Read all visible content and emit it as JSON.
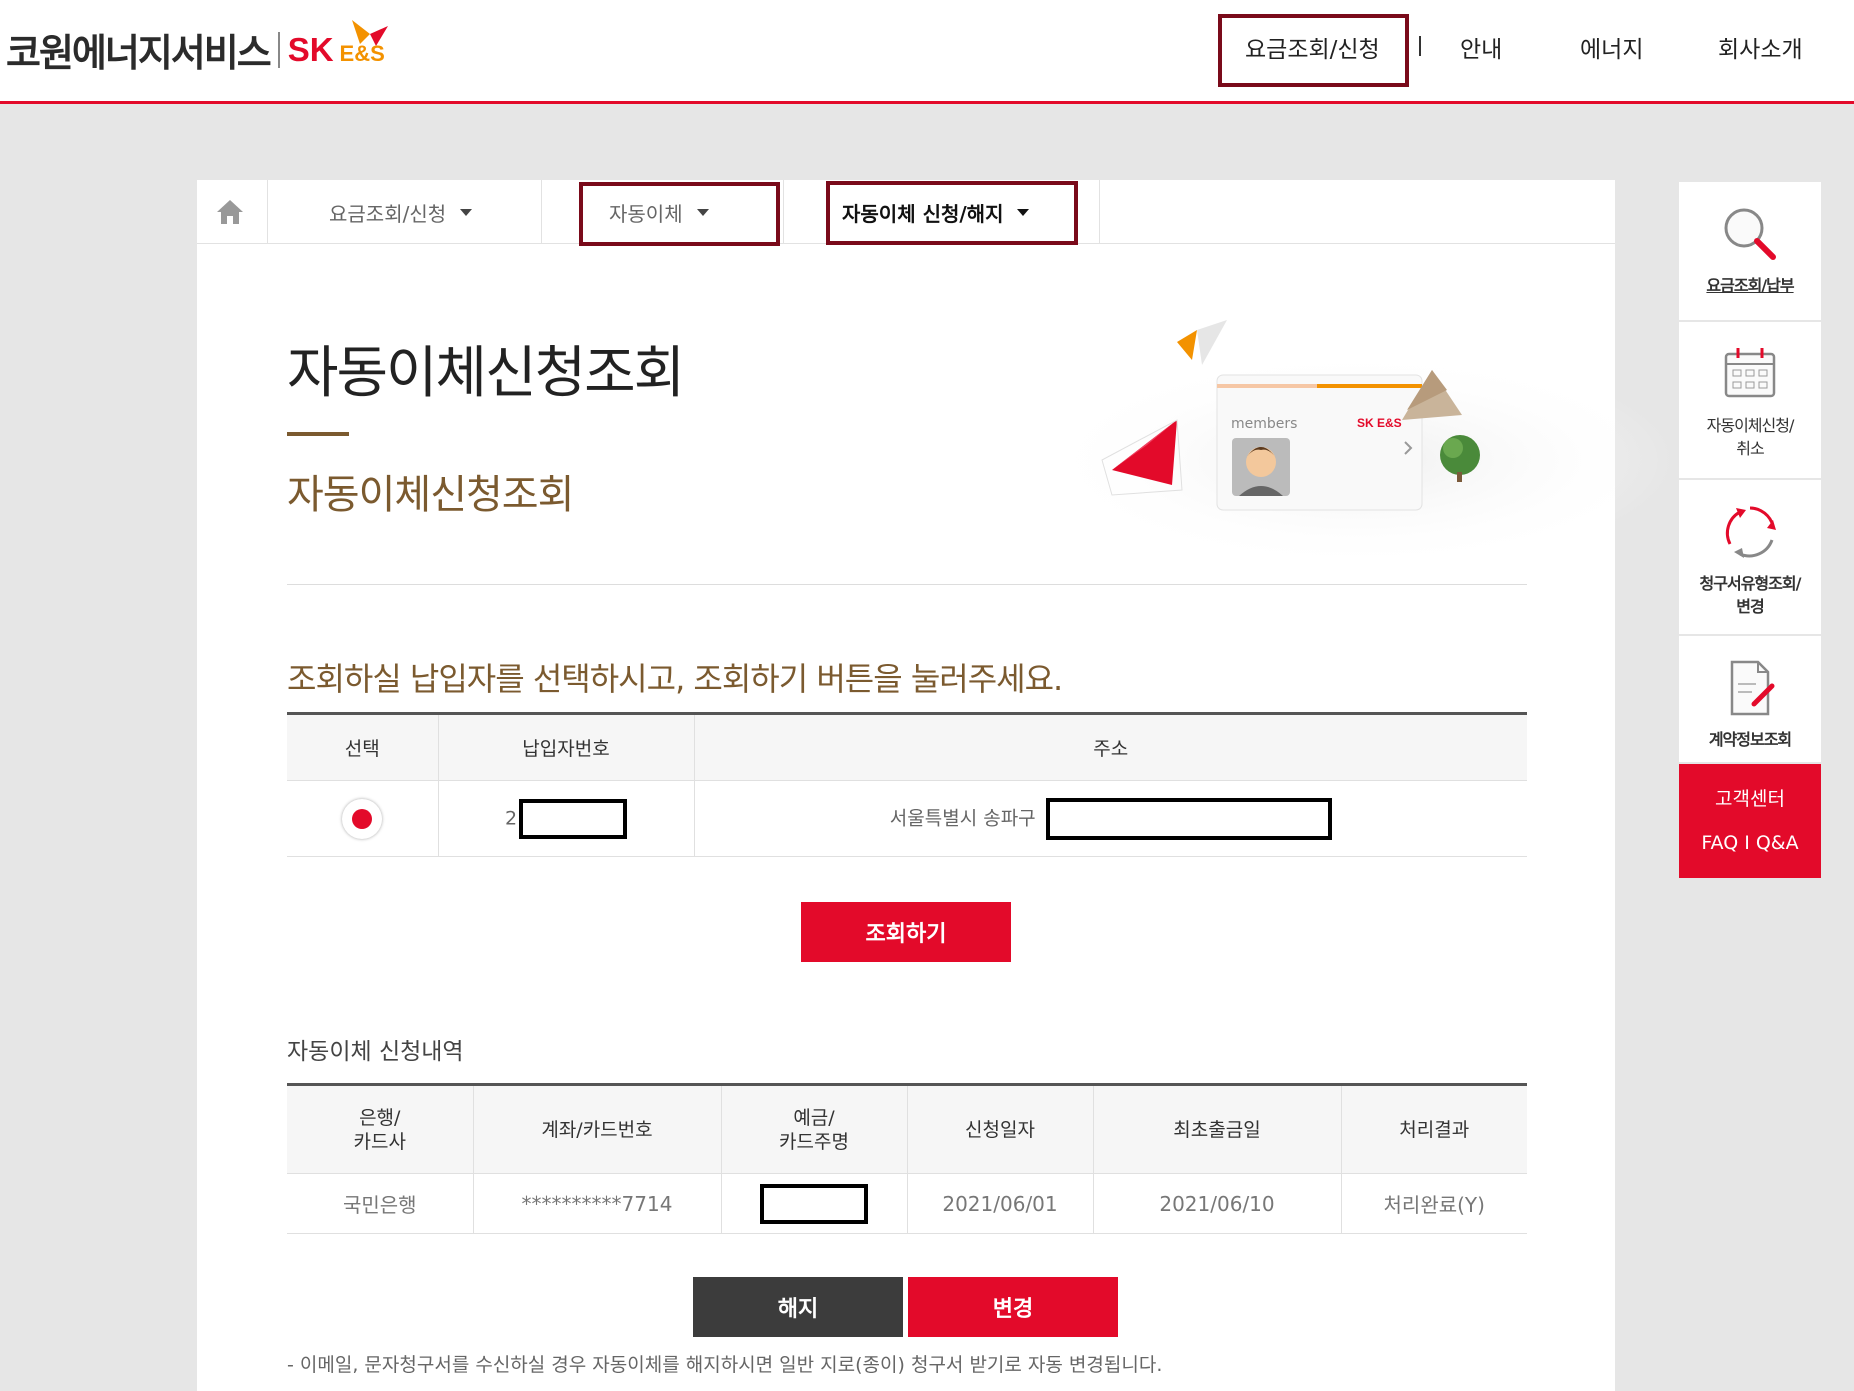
{
  "header": {
    "logo_text": "코원에너지서비스",
    "logo_sk": "SK",
    "logo_es": "E&S",
    "nav": [
      {
        "label": "요금조회/신청"
      },
      {
        "label": "안내"
      },
      {
        "label": "에너지"
      },
      {
        "label": "회사소개"
      }
    ]
  },
  "breadcrumb": {
    "home_icon": "home-icon",
    "level1": "요금조회/신청",
    "level2": "자동이체",
    "level3": "자동이체 신청/해지"
  },
  "page": {
    "title": "자동이체신청조회",
    "subtitle": "자동이체신청조회",
    "hero_card_label": "members",
    "hero_card_brand": "SK E&S",
    "guide": "조회하실 납입자를 선택하시고, 조회하기 버튼을 눌러주세요."
  },
  "payer_table": {
    "headers": [
      "선택",
      "납입자번호",
      "주소"
    ],
    "rows": [
      {
        "selected": true,
        "payer_no": "2",
        "address": "서울특별시 송파구"
      }
    ]
  },
  "search_button": "조회하기",
  "history": {
    "title": "자동이체 신청내역",
    "headers": [
      "은행/\n카드사",
      "계좌/카드번호",
      "예금/\n카드주명",
      "신청일자",
      "최초출금일",
      "처리결과"
    ],
    "rows": [
      {
        "bank": "국민은행",
        "account": "**********7714",
        "owner": "",
        "apply_date": "2021/06/01",
        "first_withdraw": "2021/06/10",
        "result": "처리완료(Y)"
      }
    ]
  },
  "buttons": {
    "cancel": "해지",
    "change": "변경"
  },
  "note": "- 이메일, 문자청구서를 수신하실 경우 자동이체를 해지하시면 일반 지로(종이) 청구서 받기로 자동 변경됩니다.",
  "quick_menu": [
    {
      "label": "요금조회/납부",
      "icon": "magnifier-icon"
    },
    {
      "label": "자동이체신청/\n취소",
      "icon": "calendar-icon"
    },
    {
      "label": "청구서유형조회/\n변경",
      "icon": "refresh-cycle-icon"
    },
    {
      "label": "계약정보조회",
      "icon": "document-pen-icon"
    }
  ],
  "customer_center": {
    "title": "고객센터",
    "links": "FAQ I Q&A"
  },
  "colors": {
    "accent": "#e30a2a",
    "brown": "#7b5a2f",
    "highlight_box": "#7a0a1a"
  }
}
